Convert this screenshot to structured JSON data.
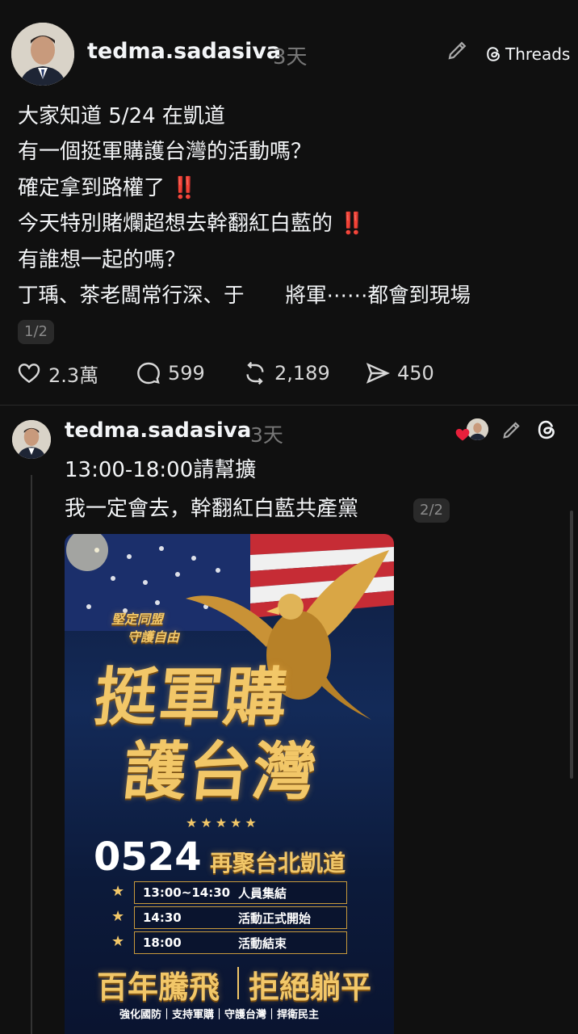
{
  "post": {
    "username": "tedma.sadasiva",
    "time": "3天",
    "threads_label": "Threads",
    "lines": [
      "大家知道 5/24 在凱道",
      "有一個挺軍購護台灣的活動嗎？",
      "確定拿到路權了",
      "今天特別賭爛超想去幹翻紅白藍的",
      "有誰想一起的嗎？",
      "丁瑀、茶老闆常行深、于　　將軍⋯⋯都會到現場"
    ],
    "emoji": "‼️",
    "pager": "1/2",
    "actions": {
      "likes": "2.3萬",
      "comments": "599",
      "reposts": "2,189",
      "shares": "450"
    }
  },
  "reply": {
    "username": "tedma.sadasiva",
    "time": "3天",
    "line1": "13:00-18:00請幫擴",
    "line2": "我一定會去，幹翻紅白藍共產黨",
    "pager": "2/2"
  },
  "poster": {
    "tagline1": "堅定同盟",
    "tagline2": "守護自由",
    "title1": "挺軍購",
    "title2": "護台灣",
    "date": "0524",
    "venue": "再聚台北凱道",
    "schedule": [
      {
        "time": "13:00~14:30",
        "desc": "人員集結"
      },
      {
        "time": "14:30",
        "desc": "活動正式開始"
      },
      {
        "time": "18:00",
        "desc": "活動結束"
      }
    ],
    "slogan1": "百年騰飛",
    "slogan2": "拒絕躺平",
    "footer": "強化國防｜支持軍購｜守護台灣｜捍衛民主"
  },
  "colors": {
    "background": "#101010",
    "gold": "#f2c768",
    "emoji_red": "#e0242d",
    "heart": "#e8203b"
  }
}
